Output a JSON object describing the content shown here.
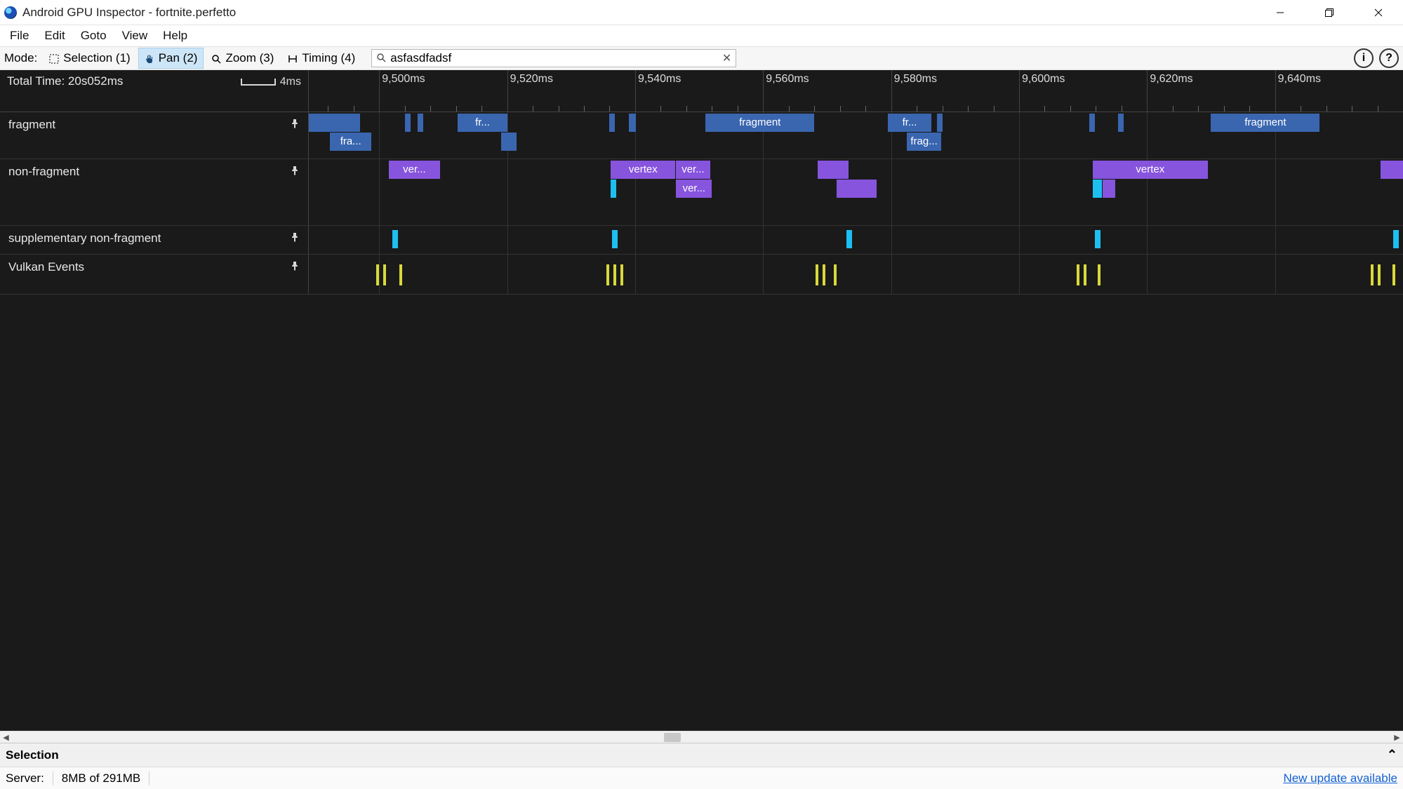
{
  "window": {
    "title": "Android GPU Inspector - fortnite.perfetto"
  },
  "menu": [
    "File",
    "Edit",
    "Goto",
    "View",
    "Help"
  ],
  "toolbar": {
    "mode_label": "Mode:",
    "modes": [
      {
        "label": "Selection (1)",
        "icon": "selection"
      },
      {
        "label": "Pan (2)",
        "icon": "pan",
        "active": true
      },
      {
        "label": "Zoom (3)",
        "icon": "zoom"
      },
      {
        "label": "Timing (4)",
        "icon": "timing"
      }
    ],
    "search_value": "asfasdfadsf",
    "info_label": "i",
    "help_label": "?"
  },
  "timeline": {
    "total_time": "Total Time: 20s052ms",
    "scale_label": "4ms",
    "ruler_start_ms": 9489,
    "ruler_end_ms": 9660,
    "major_ticks": [
      {
        "ms": 9500,
        "label": "9,500ms"
      },
      {
        "ms": 9520,
        "label": "9,520ms"
      },
      {
        "ms": 9540,
        "label": "9,540ms"
      },
      {
        "ms": 9560,
        "label": "9,560ms"
      },
      {
        "ms": 9580,
        "label": "9,580ms"
      },
      {
        "ms": 9600,
        "label": "9,600ms"
      },
      {
        "ms": 9620,
        "label": "9,620ms"
      },
      {
        "ms": 9640,
        "label": "9,640ms"
      }
    ],
    "tracks": [
      {
        "name": "fragment",
        "height": "h1",
        "slices": [
          {
            "row": 0,
            "start": 9489,
            "end": 9497,
            "label": "",
            "color": "blue"
          },
          {
            "row": 1,
            "start": 9492.3,
            "end": 9498.8,
            "label": "fra...",
            "color": "blue"
          },
          {
            "row": 0,
            "start": 9504,
            "end": 9504.4,
            "label": "",
            "color": "blue"
          },
          {
            "row": 0,
            "start": 9506,
            "end": 9506.6,
            "label": "",
            "color": "blue"
          },
          {
            "row": 0,
            "start": 9512.3,
            "end": 9520,
            "label": "fr...",
            "color": "blue"
          },
          {
            "row": 1,
            "start": 9519,
            "end": 9521.5,
            "label": "",
            "color": "blue"
          },
          {
            "row": 0,
            "start": 9536,
            "end": 9536.4,
            "label": "",
            "color": "blue"
          },
          {
            "row": 0,
            "start": 9539,
            "end": 9540.1,
            "label": "",
            "color": "blue"
          },
          {
            "row": 0,
            "start": 9551,
            "end": 9568,
            "label": "fragment",
            "color": "blue"
          },
          {
            "row": 0,
            "start": 9579.5,
            "end": 9586.3,
            "label": "fr...",
            "color": "blue"
          },
          {
            "row": 1,
            "start": 9582.5,
            "end": 9587.8,
            "label": "frag...",
            "color": "blue"
          },
          {
            "row": 0,
            "start": 9587.2,
            "end": 9587.7,
            "label": "",
            "color": "blue"
          },
          {
            "row": 0,
            "start": 9611,
            "end": 9611.4,
            "label": "",
            "color": "blue"
          },
          {
            "row": 0,
            "start": 9615.5,
            "end": 9616.4,
            "label": "",
            "color": "blue"
          },
          {
            "row": 0,
            "start": 9630,
            "end": 9647,
            "label": "fragment",
            "color": "blue"
          }
        ]
      },
      {
        "name": "non-fragment",
        "height": "h2",
        "slices": [
          {
            "row": 0,
            "start": 9501.5,
            "end": 9509.5,
            "label": "ver...",
            "color": "purple"
          },
          {
            "row": 0,
            "start": 9536.2,
            "end": 9546.3,
            "label": "vertex",
            "color": "purple"
          },
          {
            "row": 1,
            "start": 9536.2,
            "end": 9537,
            "label": "",
            "color": "cyan"
          },
          {
            "row": 0,
            "start": 9546.4,
            "end": 9551.7,
            "label": "ver...",
            "color": "purple"
          },
          {
            "row": 1,
            "start": 9546.4,
            "end": 9552,
            "label": "ver...",
            "color": "purple"
          },
          {
            "row": 0,
            "start": 9568.5,
            "end": 9573.3,
            "label": "",
            "color": "purple"
          },
          {
            "row": 1,
            "start": 9571.5,
            "end": 9577.7,
            "label": "",
            "color": "purple"
          },
          {
            "row": 0,
            "start": 9611.5,
            "end": 9629.5,
            "label": "vertex",
            "color": "purple"
          },
          {
            "row": 1,
            "start": 9611.5,
            "end": 9613,
            "label": "",
            "color": "cyan"
          },
          {
            "row": 1,
            "start": 9613,
            "end": 9615,
            "label": "",
            "color": "purple"
          },
          {
            "row": 0,
            "start": 9656.5,
            "end": 9660,
            "label": "",
            "color": "purple"
          }
        ]
      },
      {
        "name": "supplementary non-fragment",
        "height": "h0",
        "ticks_cyan": [
          9502,
          9536.4,
          9573,
          9611.8,
          9658.5
        ]
      },
      {
        "name": "Vulkan Events",
        "height": "h3",
        "ticks_yellow": [
          9499.5,
          9500.6,
          9503.2,
          9535.5,
          9536.6,
          9537.7,
          9568.2,
          9569.3,
          9571,
          9609,
          9610.1,
          9612.3,
          9655,
          9656.1,
          9658.3
        ]
      }
    ]
  },
  "hscroll": {
    "thumb_left_pct": 47.3,
    "thumb_width_pct": 1.2
  },
  "selection_panel": {
    "title": "Selection"
  },
  "statusbar": {
    "server_label": "Server:",
    "memory": "8MB of 291MB",
    "update": "New update available"
  }
}
